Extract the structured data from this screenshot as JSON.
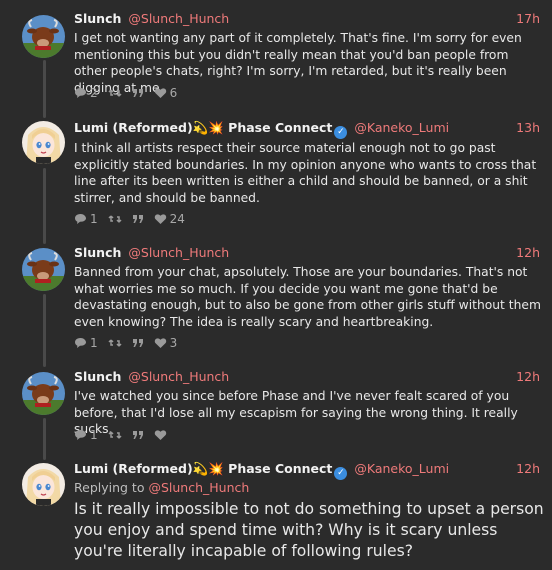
{
  "posts": [
    {
      "name": "Slunch",
      "handle": "@Slunch_Hunch",
      "time": "17h",
      "text": "I get not wanting any part of it completely. That's fine. I'm sorry for even mentioning this but you didn't really mean that you'd ban people from other people's chats, right? I'm sorry, I'm retarded, but it's really been digging at me.",
      "replies": "2",
      "likes": "6"
    },
    {
      "name": "Lumi (Reformed)💫💥 Phase Connect",
      "handle": "@Kaneko_Lumi",
      "time": "13h",
      "text": "I think all artists respect their source material enough not to go past explicitly stated boundaries. In my opinion anyone who wants to cross that line after its been written is either a child and should be banned, or a shit stirrer, and should be banned.",
      "replies": "1",
      "likes": "24"
    },
    {
      "name": "Slunch",
      "handle": "@Slunch_Hunch",
      "time": "12h",
      "text": "Banned from your chat, apsolutely. Those are your boundaries. That's not what worries me so much. If you decide you want me gone that'd be devastating enough, but to also be gone from other girls stuff without them even knowing? The idea is really scary and heartbreaking.",
      "replies": "1",
      "likes": "3"
    },
    {
      "name": "Slunch",
      "handle": "@Slunch_Hunch",
      "time": "12h",
      "text": "I've watched you since before Phase and I've never fealt scared of you before, that I'd lose all my escapism for saying the wrong thing. It really sucks.",
      "replies": "1",
      "likes": ""
    },
    {
      "name": "Lumi (Reformed)💫💥 Phase Connect",
      "handle": "@Kaneko_Lumi",
      "time": "12h",
      "replying_prefix": "Replying to",
      "replying_to": "@Slunch_Hunch",
      "text": "Is it really impossible to not do something to upset a person you enjoy and spend time with? Why is it scary unless you're literally incapable of following rules?"
    }
  ],
  "icons": {
    "reply": "reply-icon",
    "retweet": "retweet-icon",
    "quote": "quote-icon",
    "like": "heart-icon",
    "verified": "verified-badge-icon"
  },
  "colors": {
    "background": "#2b2b2b",
    "accent": "#ee7a7a",
    "verified": "#3b8ee0"
  }
}
